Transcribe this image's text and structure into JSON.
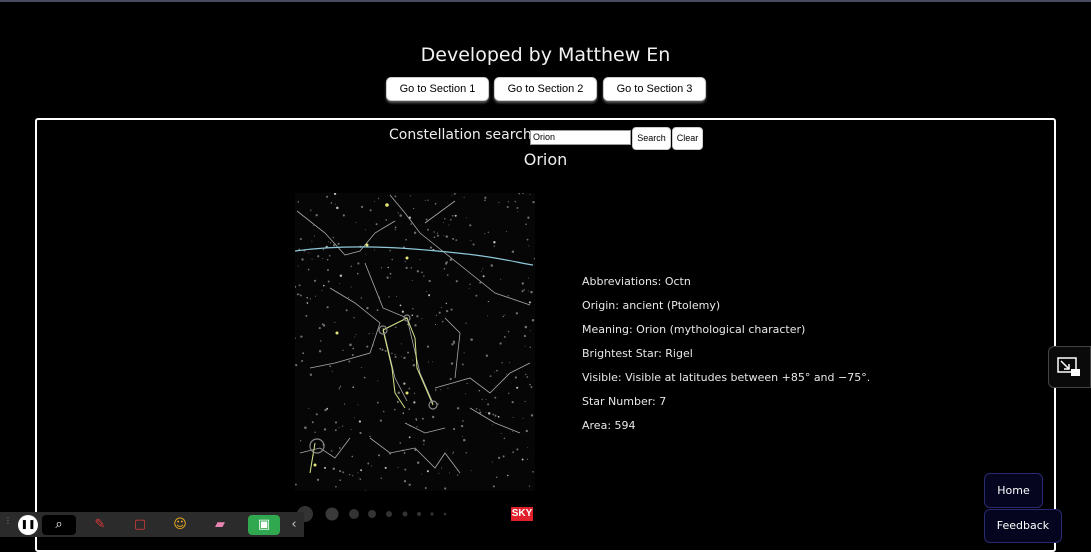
{
  "header": {
    "title": "Developed by Matthew En",
    "nav": [
      "Go to Section 1",
      "Go to Section 2",
      "Go to Section 3"
    ]
  },
  "search": {
    "label": "Constellation search:",
    "value": "Orion",
    "search_label": "Search",
    "clear_label": "Clear"
  },
  "constellation": {
    "name": "Orion",
    "map_badge": "SKY",
    "details": [
      "Abbreviations: Octn",
      "Origin: ancient (Ptolemy)",
      "Meaning: Orion (mythological character)",
      "Brightest Star: Rigel",
      "Visible: Visible at latitudes between +85° and −75°.",
      "Star Number: 7",
      "Area: 594"
    ]
  },
  "floating": {
    "home_label": "Home",
    "feedback_label": "Feedback",
    "side_icon": "exit-picture-in-picture-icon"
  },
  "taskbar": {
    "icons": [
      "pause-icon",
      "cursor-icon",
      "pen-icon",
      "square-icon",
      "emoji-icon",
      "eraser-icon",
      "screen-icon",
      "collapse-icon"
    ]
  },
  "colors": {
    "background": "#000000",
    "panel_border": "#ffffff",
    "button_dark": "#050520",
    "map_badge": "#e0202a"
  }
}
